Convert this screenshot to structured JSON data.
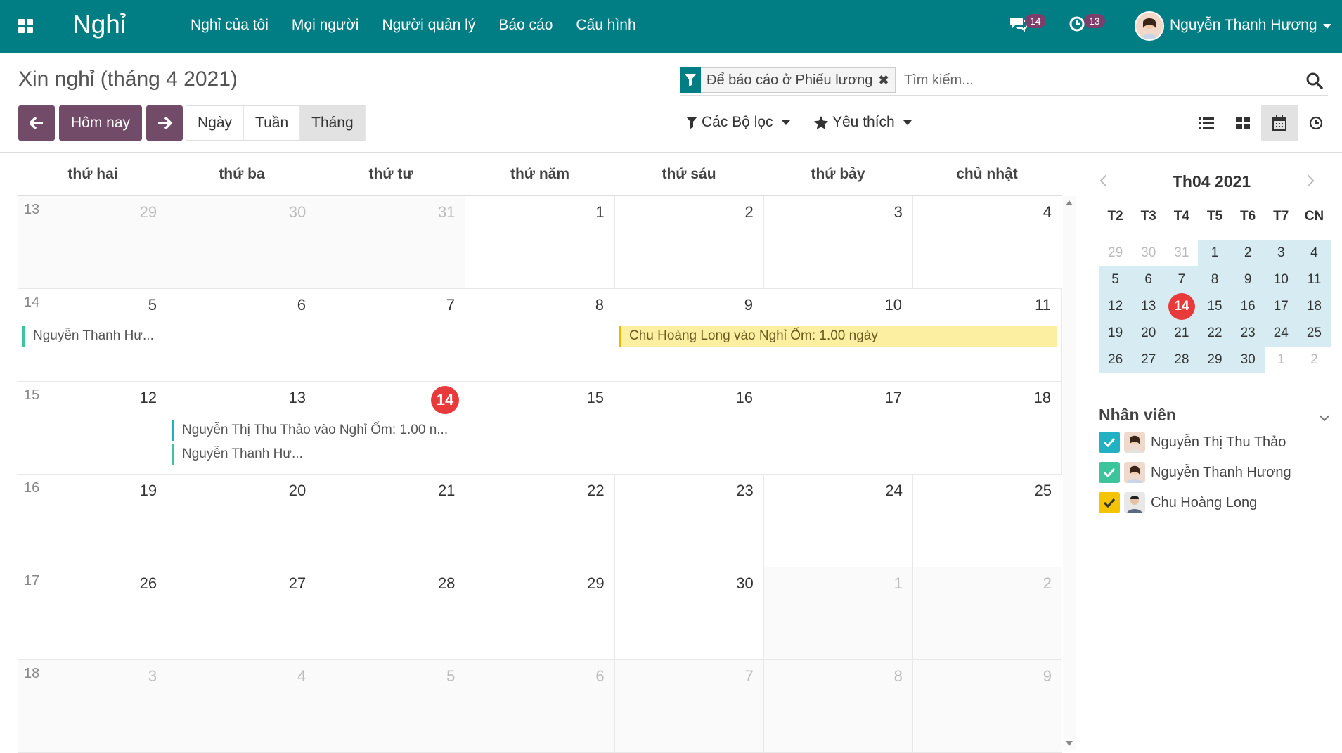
{
  "navbar": {
    "app_name": "Nghỉ",
    "menu": [
      "Nghỉ của tôi",
      "Mọi người",
      "Người quản lý",
      "Báo cáo",
      "Cấu hình"
    ],
    "messages_count": "14",
    "activities_count": "13",
    "user_name": "Nguyễn Thanh Hương",
    "background_color": "#017E84"
  },
  "control_panel": {
    "title": "Xin nghỉ (tháng 4 2021)",
    "facet_label": "Để báo cáo ở Phiếu lương",
    "facet_remove": "✖",
    "search_placeholder": "Tìm kiếm...",
    "today_label": "Hôm nay",
    "scales": [
      "Ngày",
      "Tuần",
      "Tháng"
    ],
    "active_scale": "Tháng",
    "filters_label": "Các Bộ lọc",
    "favorites_label": "Yêu thích",
    "primary_color": "#714B67"
  },
  "calendar": {
    "day_headers": [
      "thứ hai",
      "thứ ba",
      "thứ tư",
      "thứ năm",
      "thứ sáu",
      "thứ bảy",
      "chủ nhật"
    ],
    "weeks": [
      {
        "week_num": "13",
        "days": [
          "29",
          "30",
          "31",
          "1",
          "2",
          "3",
          "4"
        ]
      },
      {
        "week_num": "14",
        "days": [
          "5",
          "6",
          "7",
          "8",
          "9",
          "10",
          "11"
        ]
      },
      {
        "week_num": "15",
        "days": [
          "12",
          "13",
          "14",
          "15",
          "16",
          "17",
          "18"
        ]
      },
      {
        "week_num": "16",
        "days": [
          "19",
          "20",
          "21",
          "22",
          "23",
          "24",
          "25"
        ]
      },
      {
        "week_num": "17",
        "days": [
          "26",
          "27",
          "28",
          "29",
          "30",
          "1",
          "2"
        ]
      },
      {
        "week_num": "18",
        "days": [
          "3",
          "4",
          "5",
          "6",
          "7",
          "8",
          "9"
        ]
      }
    ],
    "events": [
      {
        "label": "Nguyễn Thanh Hư...",
        "color": "green"
      },
      {
        "label": "Chu Hoàng Long vào Nghỉ Ốm: 1.00 ngày",
        "color": "yellow"
      },
      {
        "label": "Nguyễn Thị Thu Thảo vào Nghỉ Ốm: 1.00 n...",
        "color": "cyan"
      },
      {
        "label": "Nguyễn Thanh Hư...",
        "color": "green"
      }
    ]
  },
  "sidebar": {
    "mini_title": "Th04 2021",
    "mini_days": [
      "T2",
      "T3",
      "T4",
      "T5",
      "T6",
      "T7",
      "CN"
    ],
    "mini_weeks": [
      [
        "29",
        "30",
        "31",
        "1",
        "2",
        "3",
        "4"
      ],
      [
        "5",
        "6",
        "7",
        "8",
        "9",
        "10",
        "11"
      ],
      [
        "12",
        "13",
        "14",
        "15",
        "16",
        "17",
        "18"
      ],
      [
        "19",
        "20",
        "21",
        "22",
        "23",
        "24",
        "25"
      ],
      [
        "26",
        "27",
        "28",
        "29",
        "30",
        "1",
        "2"
      ]
    ],
    "filters_title": "Nhân viên",
    "employees": [
      {
        "name": "Nguyễn Thị Thu Thảo",
        "color": "#22b0c3"
      },
      {
        "name": "Nguyễn Thanh Hương",
        "color": "#3cc49a"
      },
      {
        "name": "Chu Hoàng Long",
        "color": "#f5c400"
      }
    ]
  }
}
